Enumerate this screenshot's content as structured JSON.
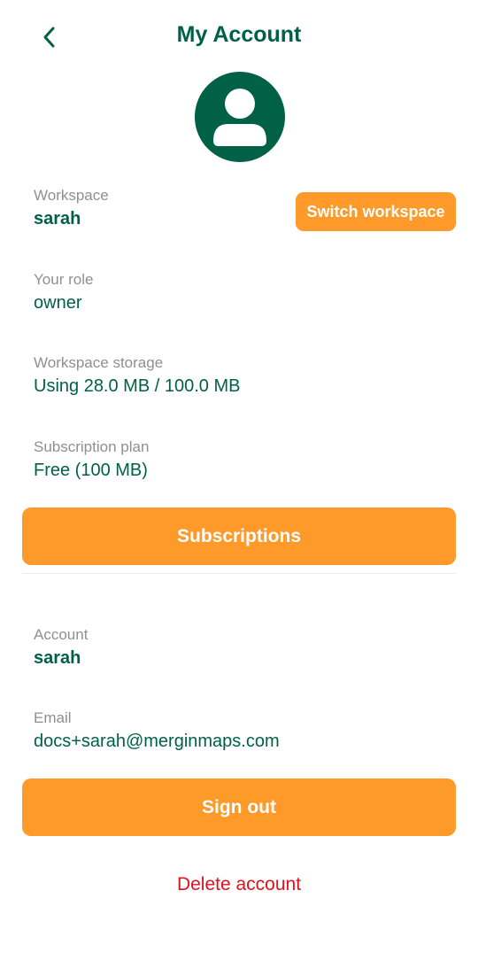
{
  "header": {
    "title": "My Account",
    "back_icon": "chevron-left-icon"
  },
  "avatar": {
    "icon": "user-icon"
  },
  "workspace": {
    "label": "Workspace",
    "value": "sarah",
    "switch_label": "Switch workspace"
  },
  "role": {
    "label": "Your role",
    "value": "owner"
  },
  "storage": {
    "label": "Workspace storage",
    "value": "Using 28.0 MB / 100.0 MB"
  },
  "subscription": {
    "label": "Subscription plan",
    "value": "Free (100 MB)",
    "button_label": "Subscriptions"
  },
  "account": {
    "label": "Account",
    "value": "sarah"
  },
  "email": {
    "label": "Email",
    "value": "docs+sarah@merginmaps.com"
  },
  "actions": {
    "sign_out_label": "Sign out",
    "delete_label": "Delete account"
  },
  "colors": {
    "primary": "#006146",
    "accent": "#fd9a2a",
    "danger": "#e0101e",
    "label": "#8f8f8f"
  }
}
